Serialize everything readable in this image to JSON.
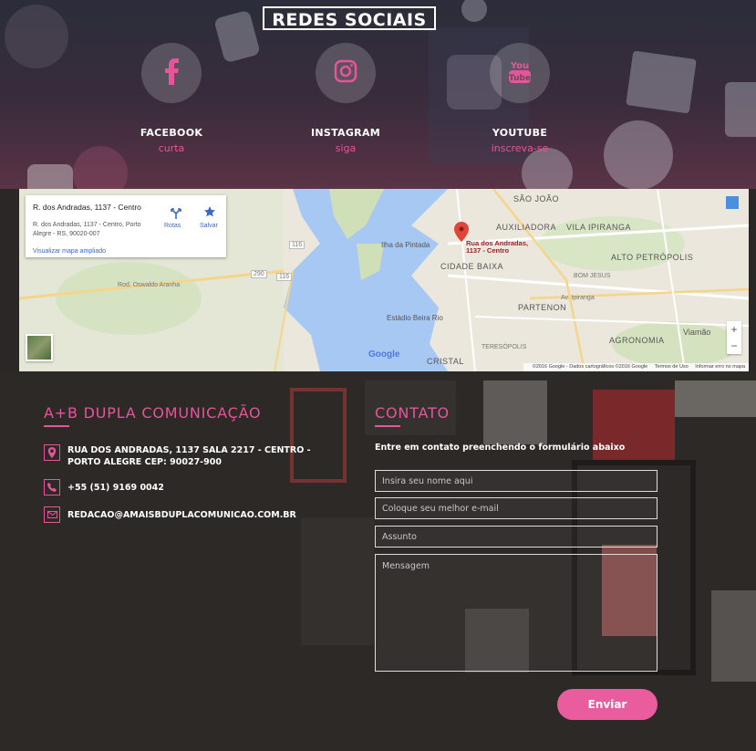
{
  "social": {
    "title": "REDES SOCIAIS",
    "items": [
      {
        "name": "FACEBOOK",
        "action": "curta",
        "icon": "facebook-icon"
      },
      {
        "name": "INSTAGRAM",
        "action": "siga",
        "icon": "instagram-icon"
      },
      {
        "name": "YOUTUBE",
        "action": "inscreva-se",
        "icon": "youtube-icon"
      }
    ]
  },
  "map": {
    "card_title": "R. dos Andradas, 1137 - Centro",
    "card_address": "R. dos Andradas, 1137 - Centro, Porto Alegre - RS, 90020-007",
    "card_link": "Visualizar mapa ampliado",
    "rotas": "Rotas",
    "salvar": "Salvar",
    "pin_label_1": "Rua dos Andradas,",
    "pin_label_2": "1137 - Centro",
    "labels": {
      "sao_joao": "SÃO JOÃO",
      "auxiliadora": "AUXILIADORA",
      "vila_ipiranga": "VILA IPIRANGA",
      "cidade_baixa": "CIDADE BAIXA",
      "alto_petropolis": "ALTO PETRÓPOLIS",
      "partenon": "PARTENON",
      "agronomia": "AGRONOMIA",
      "cristal": "CRISTAL",
      "viamao": "Viamão",
      "ilha_pintada": "Ilha da Pintada",
      "estadio": "Estádio Beira Rio",
      "bom_jesus": "BOM JESUS",
      "teresopolis": "TERESÓPOLIS",
      "rod": "Rod. Oswaldo Aranha",
      "r116a": "116",
      "r116b": "116",
      "r290": "290",
      "av_ipiranga": "Av. Ipiranga"
    },
    "google": "Google",
    "footer": [
      "©2016 Google - Dados cartográficos ©2016 Google",
      "Termos de Uso",
      "Informar erro no mapa"
    ],
    "zoom_in": "+",
    "zoom_out": "−"
  },
  "company": {
    "title": "A+B DUPLA COMUNICAÇÃO",
    "address": "RUA DOS ANDRADAS, 1137 SALA 2217 - CENTRO - PORTO ALEGRE CEP: 90027-900",
    "phone": "+55 (51) 9169 0042",
    "email": "REDACAO@AMAISBDUPLACOMUNICAO.COM.BR"
  },
  "contact": {
    "title": "CONTATO",
    "subtitle": "Entre em contato preenchendo o formulário abaixo",
    "name_placeholder": "Insira seu nome aqui",
    "email_placeholder": "Coloque seu melhor e-mail",
    "subject_placeholder": "Assunto",
    "message_placeholder": "Mensagem",
    "send_label": "Enviar"
  },
  "colors": {
    "accent": "#e6559a"
  }
}
